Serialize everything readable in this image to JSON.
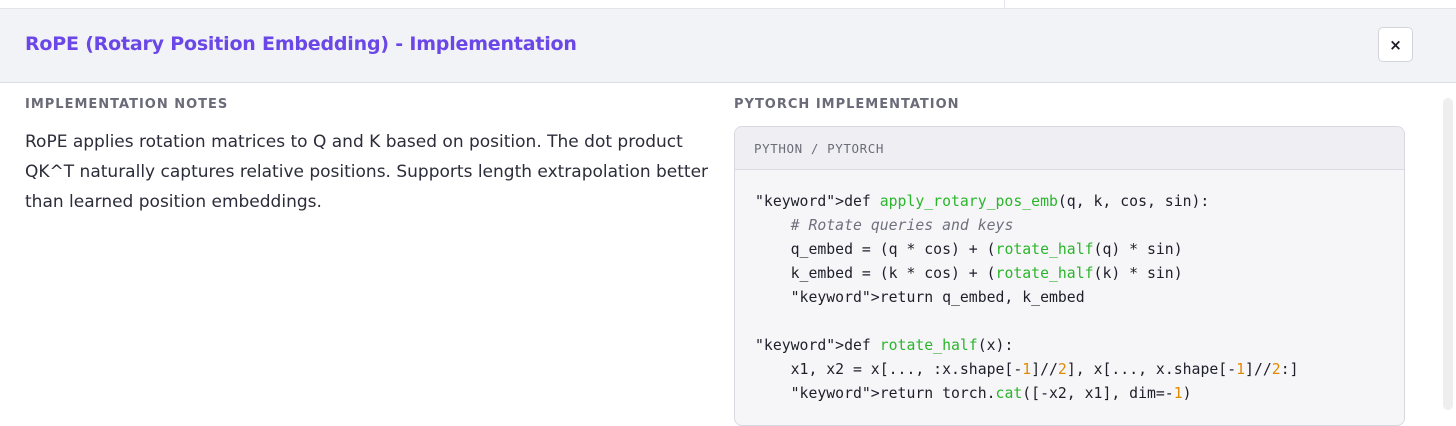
{
  "modal": {
    "title": "RoPE (Rotary Position Embedding) - Implementation",
    "close_label": "×"
  },
  "notes": {
    "label": "IMPLEMENTATION NOTES",
    "text": "RoPE applies rotation matrices to Q and K based on position. The dot product QK^T naturally captures relative positions. Supports length extrapolation better than learned position embeddings."
  },
  "code": {
    "section_label": "PYTORCH IMPLEMENTATION",
    "language_label": "PYTHON / PYTORCH",
    "lines": [
      [
        {
          "t": "\"keyword\">def "
        },
        {
          "t": "apply_rotary_pos_emb",
          "c": "fn"
        },
        {
          "t": "(q, k, cos, sin):"
        }
      ],
      [
        {
          "t": "    "
        },
        {
          "t": "# Rotate queries and keys",
          "c": "cmt"
        }
      ],
      [
        {
          "t": "    q_embed = (q * cos) + ("
        },
        {
          "t": "rotate_half",
          "c": "fn"
        },
        {
          "t": "(q) * sin)"
        }
      ],
      [
        {
          "t": "    k_embed = (k * cos) + ("
        },
        {
          "t": "rotate_half",
          "c": "fn"
        },
        {
          "t": "(k) * sin)"
        }
      ],
      [
        {
          "t": "    \"keyword\">return q_embed, k_embed"
        }
      ],
      [],
      [
        {
          "t": "\"keyword\">def "
        },
        {
          "t": "rotate_half",
          "c": "fn"
        },
        {
          "t": "(x):"
        }
      ],
      [
        {
          "t": "    x1, x2 = x[..., :x.shape[-"
        },
        {
          "t": "1",
          "c": "num"
        },
        {
          "t": "]//"
        },
        {
          "t": "2",
          "c": "num"
        },
        {
          "t": "], x[..., x.shape[-"
        },
        {
          "t": "1",
          "c": "num"
        },
        {
          "t": "]//"
        },
        {
          "t": "2",
          "c": "num"
        },
        {
          "t": ":]"
        }
      ],
      [
        {
          "t": "    \"keyword\">return torch."
        },
        {
          "t": "cat",
          "c": "fn"
        },
        {
          "t": "([-x2, x1], dim=-"
        },
        {
          "t": "1",
          "c": "num"
        },
        {
          "t": ")"
        }
      ]
    ]
  }
}
